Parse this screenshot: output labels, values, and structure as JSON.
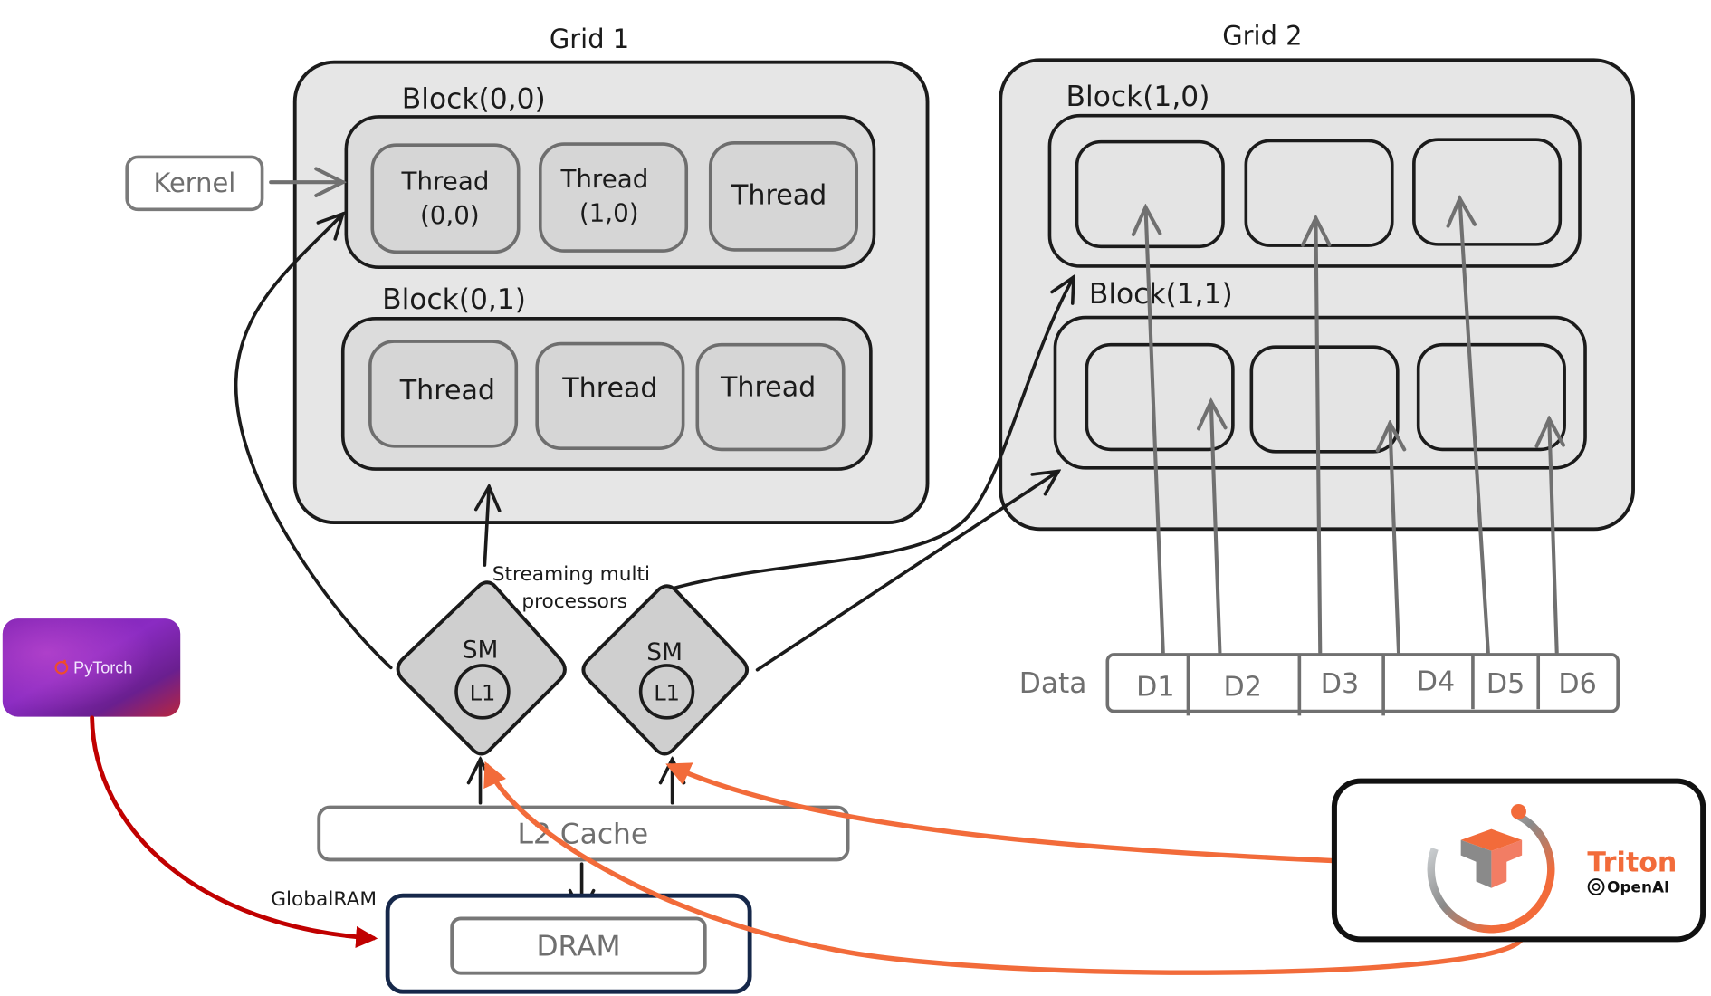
{
  "diagram": {
    "grid1": {
      "title": "Grid 1",
      "blocks": [
        {
          "label": "Block(0,0)",
          "threads": [
            {
              "line1": "Thread",
              "line2": "(0,0)"
            },
            {
              "line1": "Thread",
              "line2": "(1,0)"
            },
            {
              "line1": "Thread",
              "line2": ""
            }
          ]
        },
        {
          "label": "Block(0,1)",
          "threads": [
            {
              "line1": "Thread",
              "line2": ""
            },
            {
              "line1": "Thread",
              "line2": ""
            },
            {
              "line1": "Thread",
              "line2": ""
            }
          ]
        }
      ]
    },
    "grid2": {
      "title": "Grid 2",
      "blocks": [
        {
          "label": "Block(1,0)"
        },
        {
          "label": "Block(1,1)"
        }
      ]
    },
    "kernel": {
      "label": "Kernel"
    },
    "sm": {
      "caption_line1": "Streaming multi",
      "caption_line2": "processors",
      "units": [
        {
          "label": "SM",
          "cache": "L1"
        },
        {
          "label": "SM",
          "cache": "L1"
        }
      ]
    },
    "l2_cache": {
      "label": "L2 Cache"
    },
    "dram": {
      "label": "DRAM",
      "annotation": "GlobalRAM"
    },
    "data": {
      "label": "Data",
      "cells": [
        "D1",
        "D2",
        "D3",
        "D4",
        "D5",
        "D6"
      ]
    },
    "pytorch": {
      "label": "PyTorch",
      "icon": "pytorch-flame-icon"
    },
    "triton": {
      "label": "Triton",
      "vendor": "OpenAI",
      "icon": "triton-logo-icon",
      "vendor_icon": "openai-logo-icon"
    },
    "colors": {
      "orange_accent": "#f26b3a",
      "red_arrow": "#c00000",
      "dram_frame": "#16284a",
      "pytorch_purple": "#8a2bc2",
      "pytorch_red": "#b8263e"
    }
  }
}
